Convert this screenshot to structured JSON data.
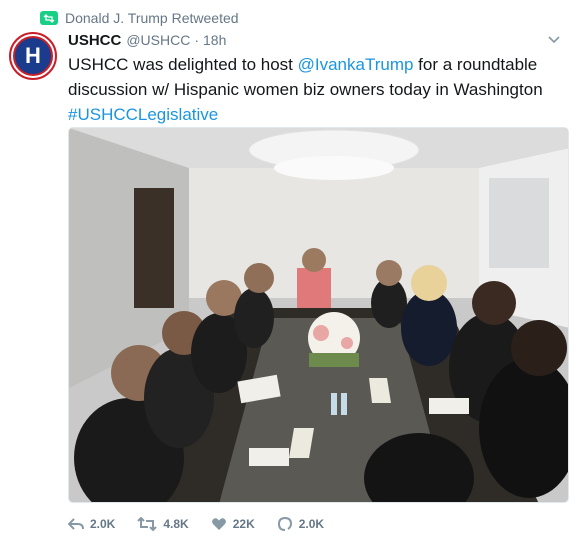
{
  "retweet_context": {
    "text": "Donald J. Trump Retweeted",
    "icon": "retweet-icon"
  },
  "author": {
    "display_name": "USHCC",
    "handle": "@USHCC",
    "time": "18h",
    "avatar_letter": "H"
  },
  "tweet": {
    "text_before": "USHCC was delighted to host ",
    "mention": "@IvankaTrump",
    "text_after": " for a roundtable discussion w/ Hispanic women biz owners today in Washington ",
    "hashtag": "#USHCCLegislative"
  },
  "actions": {
    "reply": {
      "icon": "reply-icon",
      "count": "2.0K"
    },
    "retweet": {
      "icon": "retweet-icon",
      "count": "4.8K"
    },
    "like": {
      "icon": "heart-icon",
      "count": "22K"
    },
    "dm": {
      "icon": "direct-message-icon",
      "count": "2.0K"
    }
  },
  "colors": {
    "retweet_green": "#19cf86",
    "link_blue": "#1b95e0",
    "muted": "#657786",
    "avatar_blue": "#1b3c8c",
    "avatar_red": "#c81f2b"
  }
}
